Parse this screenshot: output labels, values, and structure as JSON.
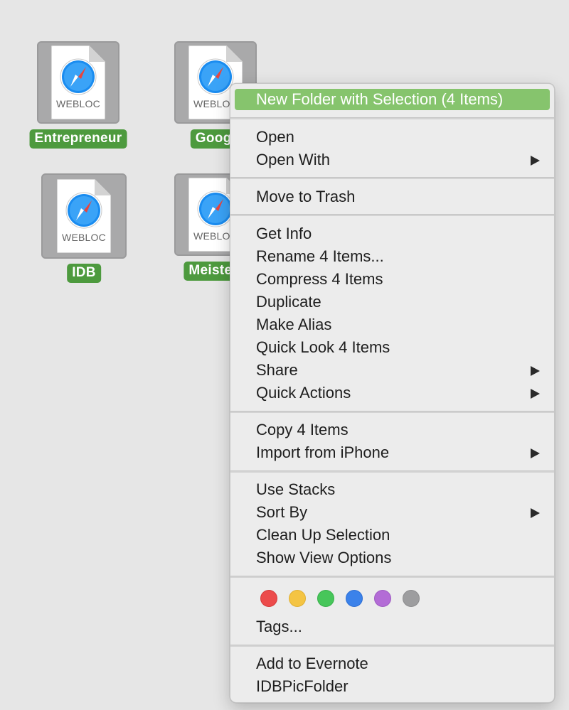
{
  "desktop": {
    "icons": [
      {
        "name": "Entrepreneur",
        "type_label": "WEBLOC"
      },
      {
        "name": "Googl",
        "type_label": "WEBLOC"
      },
      {
        "name": "IDB",
        "type_label": "WEBLOC"
      },
      {
        "name": "Meistert",
        "type_label": "WEBLOC"
      }
    ],
    "selection_color": "#4d9a3e"
  },
  "context_menu": {
    "highlighted_item": "New Folder with Selection (4 Items)",
    "highlight_color": "#86c46d",
    "items": {
      "new_folder": "New Folder with Selection (4 Items)",
      "open": "Open",
      "open_with": "Open With",
      "move_to_trash": "Move to Trash",
      "get_info": "Get Info",
      "rename": "Rename 4 Items...",
      "compress": "Compress 4 Items",
      "duplicate": "Duplicate",
      "make_alias": "Make Alias",
      "quick_look": "Quick Look 4 Items",
      "share": "Share",
      "quick_actions": "Quick Actions",
      "copy": "Copy 4 Items",
      "import_iphone": "Import from iPhone",
      "use_stacks": "Use Stacks",
      "sort_by": "Sort By",
      "clean_up": "Clean Up Selection",
      "show_view_options": "Show View Options",
      "tags": "Tags...",
      "add_evernote": "Add to Evernote",
      "idb_pic_folder": "IDBPicFolder"
    },
    "tag_colors": [
      {
        "name": "red",
        "color": "#ec4b4b"
      },
      {
        "name": "orange",
        "color": "#f4c443"
      },
      {
        "name": "green",
        "color": "#47c65a"
      },
      {
        "name": "blue",
        "color": "#3b82ea"
      },
      {
        "name": "purple",
        "color": "#b36cd6"
      },
      {
        "name": "gray",
        "color": "#9d9d9f"
      }
    ]
  }
}
